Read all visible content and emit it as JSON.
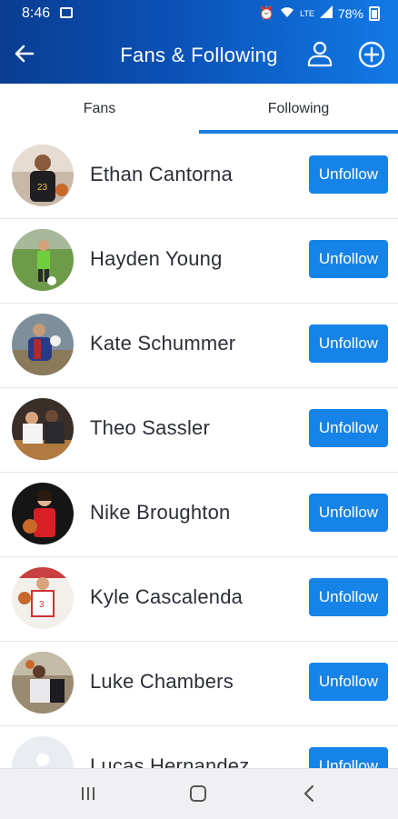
{
  "status_bar": {
    "time": "8:46",
    "battery": "78%",
    "network": "LTE"
  },
  "app_bar": {
    "title": "Fans & Following"
  },
  "tabs": [
    {
      "label": "Fans"
    },
    {
      "label": "Following"
    }
  ],
  "active_tab": "Following",
  "following": [
    {
      "name": "Ethan Cantorna",
      "action": "Unfollow"
    },
    {
      "name": "Hayden Young",
      "action": "Unfollow"
    },
    {
      "name": "Kate Schummer",
      "action": "Unfollow"
    },
    {
      "name": "Theo Sassler",
      "action": "Unfollow"
    },
    {
      "name": "Nike Broughton",
      "action": "Unfollow"
    },
    {
      "name": "Kyle Cascalenda",
      "action": "Unfollow"
    },
    {
      "name": "Luke Chambers",
      "action": "Unfollow"
    },
    {
      "name": "Lucas Hernandez",
      "action": "Unfollow"
    }
  ],
  "colors": {
    "accent": "#1683e8",
    "header_dark": "#0a3d91",
    "header_light": "#1279e6"
  }
}
